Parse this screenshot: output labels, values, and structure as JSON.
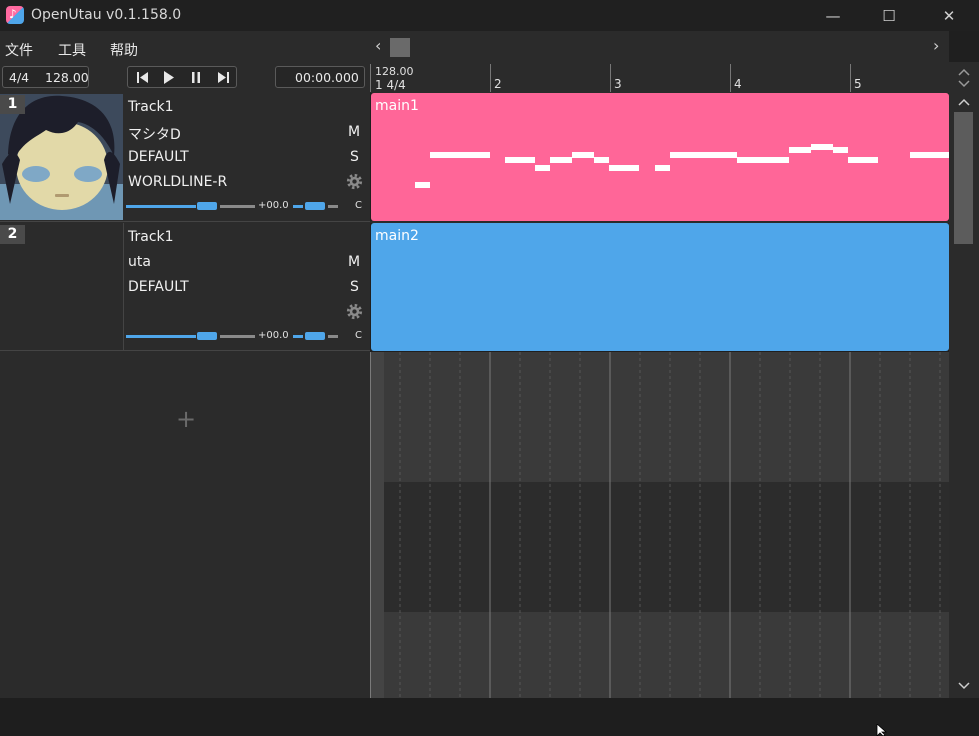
{
  "window": {
    "title": "OpenUtau v0.1.158.0",
    "icon_glyph": "♪",
    "minimize": "—",
    "maximize": "☐",
    "close": "✕"
  },
  "menu": {
    "items": [
      "文件",
      "工具",
      "帮助"
    ]
  },
  "controls": {
    "time_signature": "4/4",
    "bpm": "128.00",
    "time_display": "00:00.000",
    "transport_icons": [
      "skip-back-icon",
      "play-icon",
      "pause-icon",
      "skip-forward-icon"
    ]
  },
  "timeline": {
    "tempo_marker": "128.00",
    "first_bar_label": "1 4/4",
    "bar_numbers": [
      "2",
      "3",
      "4",
      "5"
    ],
    "scroll_left": "‹",
    "scroll_right": "›"
  },
  "tracks": [
    {
      "number": "1",
      "name": "Track1",
      "singer": "マシタD",
      "phonemizer": "DEFAULT",
      "renderer": "WORLDLINE-R",
      "mute": "M",
      "solo": "S",
      "volume": "+00.0",
      "pan": "C",
      "has_avatar": true,
      "part": {
        "name": "main1",
        "color": "#ff6698"
      }
    },
    {
      "number": "2",
      "name": "Track1",
      "singer": "uta",
      "phonemizer": "DEFAULT",
      "renderer": "",
      "mute": "M",
      "solo": "S",
      "volume": "+00.0",
      "pan": "C",
      "has_avatar": false,
      "part": {
        "name": "main2",
        "color": "#4fa6ea"
      }
    }
  ],
  "add_track": "+",
  "colors": {
    "accent_blue": "#4fa6ea",
    "accent_pink": "#ff6698",
    "panel": "#2b2b2b"
  }
}
